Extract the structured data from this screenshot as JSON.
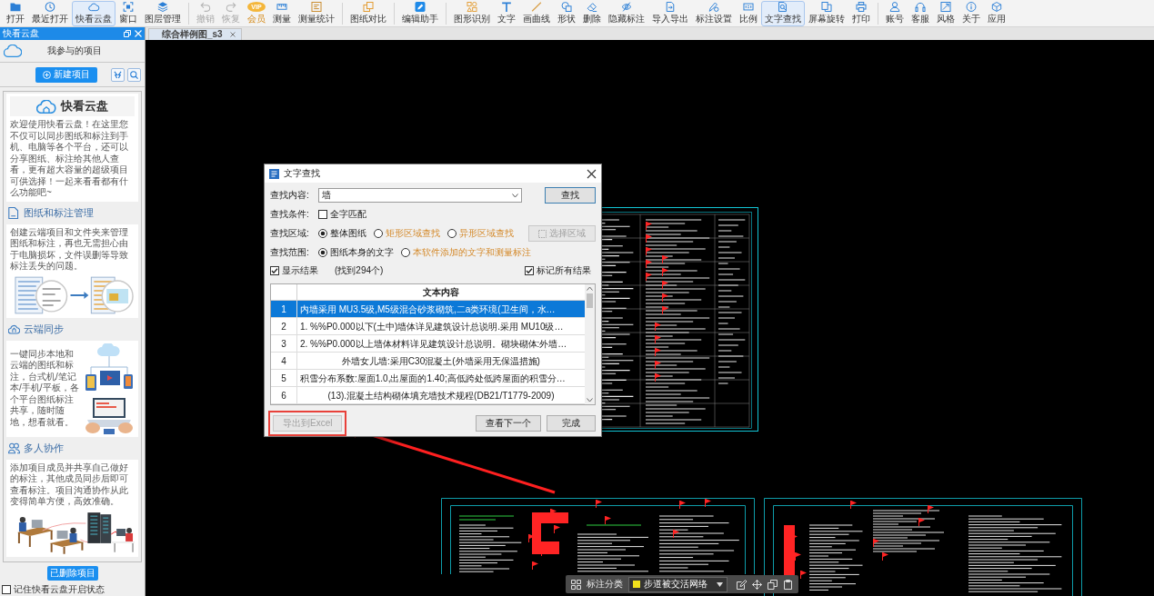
{
  "toolbar": {
    "groups": [
      [
        {
          "label": "打开",
          "selected": false,
          "disabled": false
        },
        {
          "label": "最近打开",
          "selected": false,
          "disabled": false
        },
        {
          "label": "快看云盘",
          "selected": true,
          "disabled": false
        },
        {
          "label": "窗口",
          "selected": false,
          "disabled": false
        },
        {
          "label": "图层管理",
          "selected": false,
          "disabled": false
        }
      ],
      [
        {
          "label": "撤销",
          "selected": false,
          "disabled": true
        },
        {
          "label": "恢复",
          "selected": false,
          "disabled": true
        },
        {
          "label": "会员",
          "badge": "VIP",
          "selected": false,
          "disabled": false
        },
        {
          "label": "测量",
          "selected": false,
          "disabled": false
        },
        {
          "label": "测量统计",
          "selected": false,
          "disabled": false
        }
      ],
      [
        {
          "label": "图纸对比",
          "selected": false,
          "disabled": false
        }
      ],
      [
        {
          "label": "编辑助手",
          "selected": false,
          "disabled": false
        }
      ],
      [
        {
          "label": "图形识别",
          "selected": false,
          "disabled": false
        },
        {
          "label": "文字",
          "selected": false,
          "disabled": false
        },
        {
          "label": "画曲线",
          "selected": false,
          "disabled": false
        },
        {
          "label": "形状",
          "selected": false,
          "disabled": false
        },
        {
          "label": "删除",
          "selected": false,
          "disabled": false
        },
        {
          "label": "隐藏标注",
          "selected": false,
          "disabled": false
        },
        {
          "label": "导入导出",
          "selected": false,
          "disabled": false
        },
        {
          "label": "标注设置",
          "selected": false,
          "disabled": false
        },
        {
          "label": "比例",
          "selected": false,
          "disabled": false
        },
        {
          "label": "文字查找",
          "selected": true,
          "disabled": false
        },
        {
          "label": "屏幕旋转",
          "selected": false,
          "disabled": false
        },
        {
          "label": "打印",
          "selected": false,
          "disabled": false
        }
      ],
      [
        {
          "label": "账号",
          "selected": false,
          "disabled": false
        },
        {
          "label": "客服",
          "selected": false,
          "disabled": false
        },
        {
          "label": "风格",
          "selected": false,
          "disabled": false
        },
        {
          "label": "关于",
          "selected": false,
          "disabled": false
        },
        {
          "label": "应用",
          "selected": false,
          "disabled": false
        }
      ]
    ]
  },
  "cloud_panel": {
    "title": "快看云盘",
    "heading": "我参与的项目",
    "new_button": "新建项目",
    "intro": {
      "title": "快看云盘",
      "text": "欢迎使用快看云盘！在这里您不仅可以同步图纸和标注到手机、电脑等各个平台，还可以分享图纸、标注给其他人查看，更有超大容量的超级项目可供选择！一起来看看都有什么功能吧~"
    },
    "sections": [
      {
        "kind": "stacked",
        "title": "图纸和标注管理",
        "text": "创建云端项目和文件夹来管理图纸和标注，再也无需担心由于电脑损坏，文件误删等导致标注丢失的问题。"
      },
      {
        "kind": "side",
        "title": "云端同步",
        "text": "一键同步本地和云端的图纸和标注，台式机/笔记本/手机/平板，各个平台图纸标注共享，随时随地，想看就看。"
      },
      {
        "kind": "stacked",
        "title": "多人协作",
        "text": "添加项目成员并共享自己做好的标注，其他成员同步后即可查看标注。项目沟通协作从此变得简单方便，高效准确。"
      }
    ],
    "deleted_button": "已删除项目",
    "remember": {
      "label": "记住快看云盘开启状态",
      "checked": false
    }
  },
  "tabs": [
    {
      "label": "综合样例图_s3",
      "selected": true
    }
  ],
  "find_dialog": {
    "title": "文字查找",
    "query": {
      "label": "查找内容:",
      "value": "墙"
    },
    "find_button": "查找",
    "condition": {
      "label": "查找条件:",
      "options": [
        {
          "label": "全字匹配",
          "checked": false
        }
      ]
    },
    "area": {
      "label": "查找区域:",
      "options": [
        {
          "label": "整体图纸",
          "selected": true
        },
        {
          "label": "矩形区域查找",
          "selected": false
        },
        {
          "label": "异形区域查找",
          "selected": false
        }
      ],
      "button": {
        "label": "选择区域",
        "disabled": true
      }
    },
    "scope": {
      "label": "查找范围:",
      "options": [
        {
          "label": "图纸本身的文字",
          "selected": true
        },
        {
          "label": "本软件添加的文字和测量标注",
          "selected": false
        }
      ]
    },
    "show_results": {
      "label": "显示结果",
      "checked": true
    },
    "found": "(找到294个)",
    "mark_all": {
      "label": "标记所有结果",
      "checked": true
    },
    "table": {
      "columns": [
        "文本内容"
      ],
      "rows": [
        {
          "index": "1",
          "text": "内墙采用 MU3.5级,M5级混合砂浆砌筑,二a类环境(卫生间，水…",
          "centered": false,
          "selected": true
        },
        {
          "index": "2",
          "text": "1. %%P0.000以下(土中)墙体详见建筑设计总说明.采用 MU10级…",
          "centered": false,
          "selected": false
        },
        {
          "index": "3",
          "text": "2. %%P0.000以上墙体材料详见建筑设计总说明。砌块砌体:外墙…",
          "centered": false,
          "selected": false
        },
        {
          "index": "4",
          "text": "外墙女儿墙:采用C30混凝土(外墙采用无保温措施)",
          "centered": true,
          "selected": false
        },
        {
          "index": "5",
          "text": "积雪分布系数:屋面1.0,出屋面的1.40;高低跨处低跨屋面的积雪分…",
          "centered": false,
          "selected": false
        },
        {
          "index": "6",
          "text": "(13).混凝土结构砌体填充墙技术规程(DB21/T1779-2009)",
          "centered": true,
          "selected": false
        }
      ]
    },
    "export_button": {
      "label": "导出到Excel",
      "disabled": true
    },
    "next_button": "查看下一个",
    "done_button": "完成"
  },
  "annotation_bar": {
    "label": "标注分类",
    "category": {
      "name": "步道被交活网络",
      "color": "#f2e21c"
    }
  }
}
